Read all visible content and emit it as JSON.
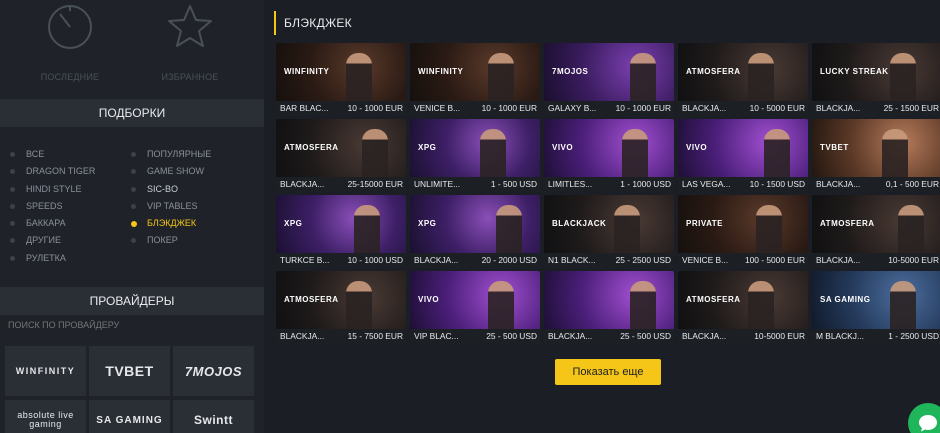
{
  "sidebar": {
    "quick": [
      {
        "label": "ПОСЛЕДНИЕ",
        "icon": "clock-icon"
      },
      {
        "label": "ИЗБРАННОЕ",
        "icon": "star-icon"
      }
    ],
    "collections_title": "ПОДБОРКИ",
    "filters_col1": [
      {
        "label": "ВСЕ"
      },
      {
        "label": "DRAGON TIGER"
      },
      {
        "label": "HINDI STYLE"
      },
      {
        "label": "SPEEDS"
      },
      {
        "label": "БАККАРА"
      },
      {
        "label": "ДРУГИЕ"
      },
      {
        "label": "РУЛЕТКА"
      }
    ],
    "filters_col2": [
      {
        "label": "ПОПУЛЯРНЫЕ"
      },
      {
        "label": "GAME SHOW"
      },
      {
        "label": "SIC-BO"
      },
      {
        "label": "VIP TABLES"
      },
      {
        "label": "БЛЭКДЖЕК",
        "active": true
      },
      {
        "label": "ПОКЕР"
      }
    ],
    "providers_title": "ПРОВАЙДЕРЫ",
    "provider_search_placeholder": "ПОИСК ПО ПРОВАЙДЕРУ",
    "providers": [
      {
        "name": "WINFINITY",
        "icon": "winfinity-logo"
      },
      {
        "name": "TVBET",
        "icon": "tvbet-logo"
      },
      {
        "name": "7MOJOS",
        "icon": "7mojos-logo"
      },
      {
        "name": "absolute live gaming",
        "icon": "absolute-live-gaming-logo"
      },
      {
        "name": "SA GAMING",
        "icon": "sa-gaming-logo"
      },
      {
        "name": "Swintt",
        "icon": "swintt-logo"
      }
    ]
  },
  "main": {
    "section_title": "БЛЭКДЖЕК",
    "games": [
      {
        "name": "BAR BLAC...",
        "limits": "10 - 1000 EUR",
        "theme": "winfinity",
        "brand": "WINFINITY"
      },
      {
        "name": "VENICE B...",
        "limits": "10 - 1000 EUR",
        "theme": "winfinity",
        "brand": "WINFINITY"
      },
      {
        "name": "GALAXY B...",
        "limits": "10 - 1000 EUR",
        "theme": "mojos",
        "brand": "7MOJOS"
      },
      {
        "name": "BLACKJA...",
        "limits": "10 - 5000 EUR",
        "theme": "dark",
        "brand": "ATMOSFERA"
      },
      {
        "name": "BLACKJA...",
        "limits": "25 - 1500 EUR",
        "theme": "dark",
        "brand": "LUCKY STREAK"
      },
      {
        "name": "BLACKJA...",
        "limits": "25-15000 EUR",
        "theme": "dark",
        "brand": "ATMOSFERA"
      },
      {
        "name": "UNLIMITE...",
        "limits": "1 - 500 USD",
        "theme": "xpg",
        "brand": "XPG"
      },
      {
        "name": "LIMITLES...",
        "limits": "1 - 1000 USD",
        "theme": "vivo",
        "brand": "VIVO"
      },
      {
        "name": "LAS VEGA...",
        "limits": "10 - 1500 USD",
        "theme": "vivo",
        "brand": "VIVO"
      },
      {
        "name": "BLACKJA...",
        "limits": "0,1 - 500 EUR",
        "theme": "tvbet",
        "brand": "TVBET"
      },
      {
        "name": "TURKCE B...",
        "limits": "10 - 1000 USD",
        "theme": "xpg",
        "brand": "XPG"
      },
      {
        "name": "BLACKJA...",
        "limits": "20 - 2000 USD",
        "theme": "xpg",
        "brand": "XPG"
      },
      {
        "name": "N1 BLACK...",
        "limits": "25 - 2500 USD",
        "theme": "dark",
        "brand": "BLACKJACK"
      },
      {
        "name": "VENICE B...",
        "limits": "100 - 5000 EUR",
        "theme": "winfinity",
        "brand": "PRIVATE"
      },
      {
        "name": "BLACKJA...",
        "limits": "10-5000 EUR",
        "theme": "dark",
        "brand": "ATMOSFERA"
      },
      {
        "name": "BLACKJA...",
        "limits": "15 - 7500 EUR",
        "theme": "dark",
        "brand": "ATMOSFERA"
      },
      {
        "name": "VIP BLAC...",
        "limits": "25 - 500 USD",
        "theme": "vivo",
        "brand": "VIVO"
      },
      {
        "name": "BLACKJA...",
        "limits": "25 - 500 USD",
        "theme": "vivo",
        "brand": ""
      },
      {
        "name": "BLACKJA...",
        "limits": "10-5000 EUR",
        "theme": "dark",
        "brand": "ATMOSFERA"
      },
      {
        "name": "M BLACKJ...",
        "limits": "1 - 2500 USD",
        "theme": "sa",
        "brand": "SA GAMING"
      }
    ],
    "show_more_label": "Показать еще"
  },
  "colors": {
    "accent": "#f5c518",
    "background": "#1b1f25",
    "chat": "#1fb55a"
  }
}
